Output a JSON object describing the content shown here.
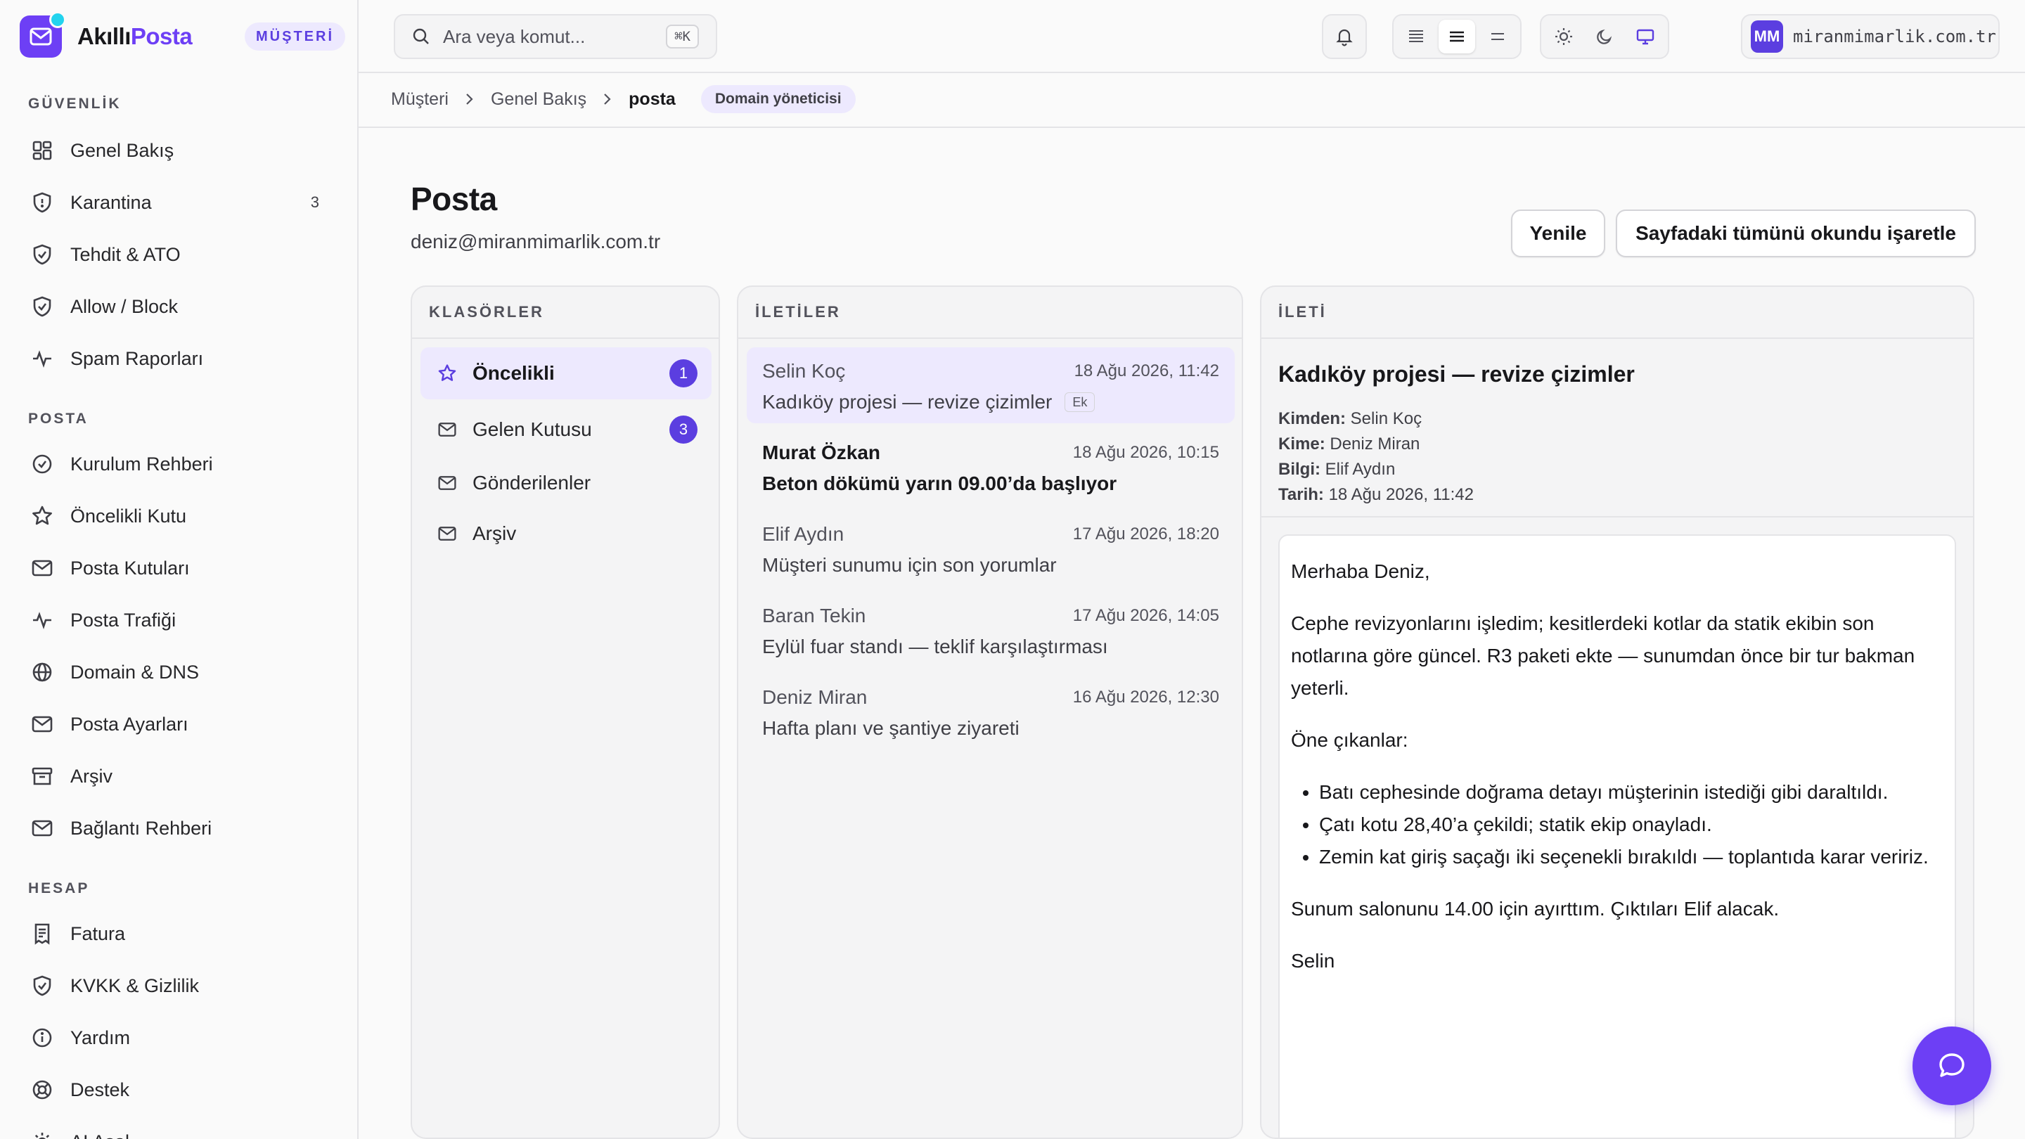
{
  "brand": {
    "name_part1": "Akıllı",
    "name_part2": "Posta",
    "badge": "MÜŞTERİ"
  },
  "sidebar": {
    "sections": [
      {
        "title": "GÜVENLİK",
        "items": [
          {
            "label": "Genel Bakış",
            "icon": "grid-icon"
          },
          {
            "label": "Karantina",
            "icon": "shield-icon",
            "count": "3"
          },
          {
            "label": "Tehdit & ATO",
            "icon": "shield-check-icon"
          },
          {
            "label": "Allow / Block",
            "icon": "shield-check-icon"
          },
          {
            "label": "Spam Raporları",
            "icon": "activity-icon"
          }
        ]
      },
      {
        "title": "POSTA",
        "items": [
          {
            "label": "Kurulum Rehberi",
            "icon": "check-circle-icon"
          },
          {
            "label": "Öncelikli Kutu",
            "icon": "star-icon"
          },
          {
            "label": "Posta Kutuları",
            "icon": "mail-icon"
          },
          {
            "label": "Posta Trafiği",
            "icon": "activity-icon"
          },
          {
            "label": "Domain & DNS",
            "icon": "globe-icon"
          },
          {
            "label": "Posta Ayarları",
            "icon": "mail-icon"
          },
          {
            "label": "Arşiv",
            "icon": "archive-icon"
          },
          {
            "label": "Bağlantı Rehberi",
            "icon": "mail-icon"
          }
        ]
      },
      {
        "title": "HESAP",
        "items": [
          {
            "label": "Fatura",
            "icon": "receipt-icon"
          },
          {
            "label": "KVKK & Gizlilik",
            "icon": "shield-check-icon"
          },
          {
            "label": "Yardım",
            "icon": "info-icon"
          },
          {
            "label": "Destek",
            "icon": "lifebuoy-icon"
          },
          {
            "label": "AI Asal...",
            "icon": "settings-icon"
          }
        ]
      }
    ]
  },
  "topbar": {
    "search_placeholder": "Ara veya komut...",
    "search_shortcut": "⌘K",
    "account_initials": "MM",
    "account_domain": "miranmimarlik.com.tr"
  },
  "breadcrumb": {
    "items": [
      "Müşteri",
      "Genel Bakış"
    ],
    "current": "posta",
    "badge": "Domain yöneticisi"
  },
  "page": {
    "title": "Posta",
    "subtitle": "deniz@miranmimarlik.com.tr",
    "refresh_label": "Yenile",
    "mark_read_label": "Sayfadaki tümünü okundu işaretle"
  },
  "folders": {
    "header": "KLASÖRLER",
    "items": [
      {
        "label": "Öncelikli",
        "icon": "star-icon",
        "count": "1",
        "active": true
      },
      {
        "label": "Gelen Kutusu",
        "icon": "mail-icon",
        "count": "3"
      },
      {
        "label": "Gönderilenler",
        "icon": "mail-icon"
      },
      {
        "label": "Arşiv",
        "icon": "mail-icon"
      }
    ]
  },
  "messages": {
    "header": "İLETİLER",
    "items": [
      {
        "from": "Selin Koç",
        "date": "18 Ağu 2026, 11:42",
        "subject": "Kadıköy projesi — revize çizimler",
        "tag": "Ek",
        "active": true
      },
      {
        "from": "Murat Özkan",
        "date": "18 Ağu 2026, 10:15",
        "subject": "Beton dökümü yarın 09.00’da başlıyor",
        "unread": true
      },
      {
        "from": "Elif Aydın",
        "date": "17 Ağu 2026, 18:20",
        "subject": "Müşteri sunumu için son yorumlar"
      },
      {
        "from": "Baran Tekin",
        "date": "17 Ağu 2026, 14:05",
        "subject": "Eylül fuar standı — teklif karşılaştırması"
      },
      {
        "from": "Deniz Miran",
        "date": "16 Ağu 2026, 12:30",
        "subject": "Hafta planı ve şantiye ziyareti"
      }
    ]
  },
  "reader": {
    "header": "İLETİ",
    "subject": "Kadıköy projesi — revize çizimler",
    "from_label": "Kimden:",
    "from": "Selin Koç",
    "to_label": "Kime:",
    "to": "Deniz Miran",
    "cc_label": "Bilgi:",
    "cc": "Elif Aydın",
    "date_label": "Tarih:",
    "date": "18 Ağu 2026, 11:42",
    "greeting": "Merhaba Deniz,",
    "para1": "Cephe revizyonlarını işledim; kesitlerdeki kotlar da statik ekibin son notlarına göre güncel. R3 paketi ekte — sunumdan önce bir tur bakman yeterli.",
    "highlights_title": "Öne çıkanlar:",
    "bullets": [
      "Batı cephesinde doğrama detayı müşterinin istediği gibi daraltıldı.",
      "Çatı kotu 28,40’a çekildi; statik ekip onayladı.",
      "Zemin kat giriş saçağı iki seçenekli bırakıldı — toplantıda karar veririz."
    ],
    "para2": "Sunum salonunu 14.00 için ayırttım. Çıktıları Elif alacak.",
    "signature": "Selin"
  },
  "colors": {
    "accent": "#6d3ff5",
    "accent_soft": "#ede9fe",
    "badge": "#5b3ee0",
    "border": "#e4e4e7"
  }
}
